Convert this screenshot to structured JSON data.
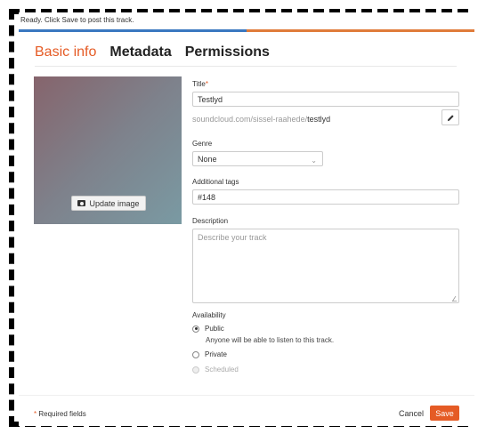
{
  "status": {
    "message": "Ready. Click Save to post this track.",
    "progress_fraction": 0.5
  },
  "colors": {
    "accent": "#e55b25",
    "progress_left": "#3a78c0",
    "progress_right": "#e07b3a"
  },
  "tabs": [
    {
      "label": "Basic info",
      "active": true
    },
    {
      "label": "Metadata",
      "active": false
    },
    {
      "label": "Permissions",
      "active": false
    }
  ],
  "image": {
    "update_label": "Update image",
    "icon": "camera-icon"
  },
  "title_field": {
    "label": "Title",
    "required_mark": "*",
    "value": "Testlyd"
  },
  "permalink": {
    "prefix": "soundcloud.com/sissel-raahede/",
    "slug": "testlyd",
    "edit_icon": "pencil-icon"
  },
  "genre": {
    "label": "Genre",
    "value": "None",
    "icon": "chevron-down-icon"
  },
  "tags": {
    "label": "Additional tags",
    "value": "#148"
  },
  "description": {
    "label": "Description",
    "placeholder": "Describe your track"
  },
  "availability": {
    "label": "Availability",
    "options": [
      {
        "label": "Public",
        "desc": "Anyone will be able to listen to this track.",
        "checked": true,
        "disabled": false
      },
      {
        "label": "Private",
        "checked": false,
        "disabled": false
      },
      {
        "label": "Scheduled",
        "checked": false,
        "disabled": true
      }
    ]
  },
  "footer": {
    "required_mark": "*",
    "required_note": "Required fields",
    "cancel": "Cancel",
    "save": "Save"
  }
}
